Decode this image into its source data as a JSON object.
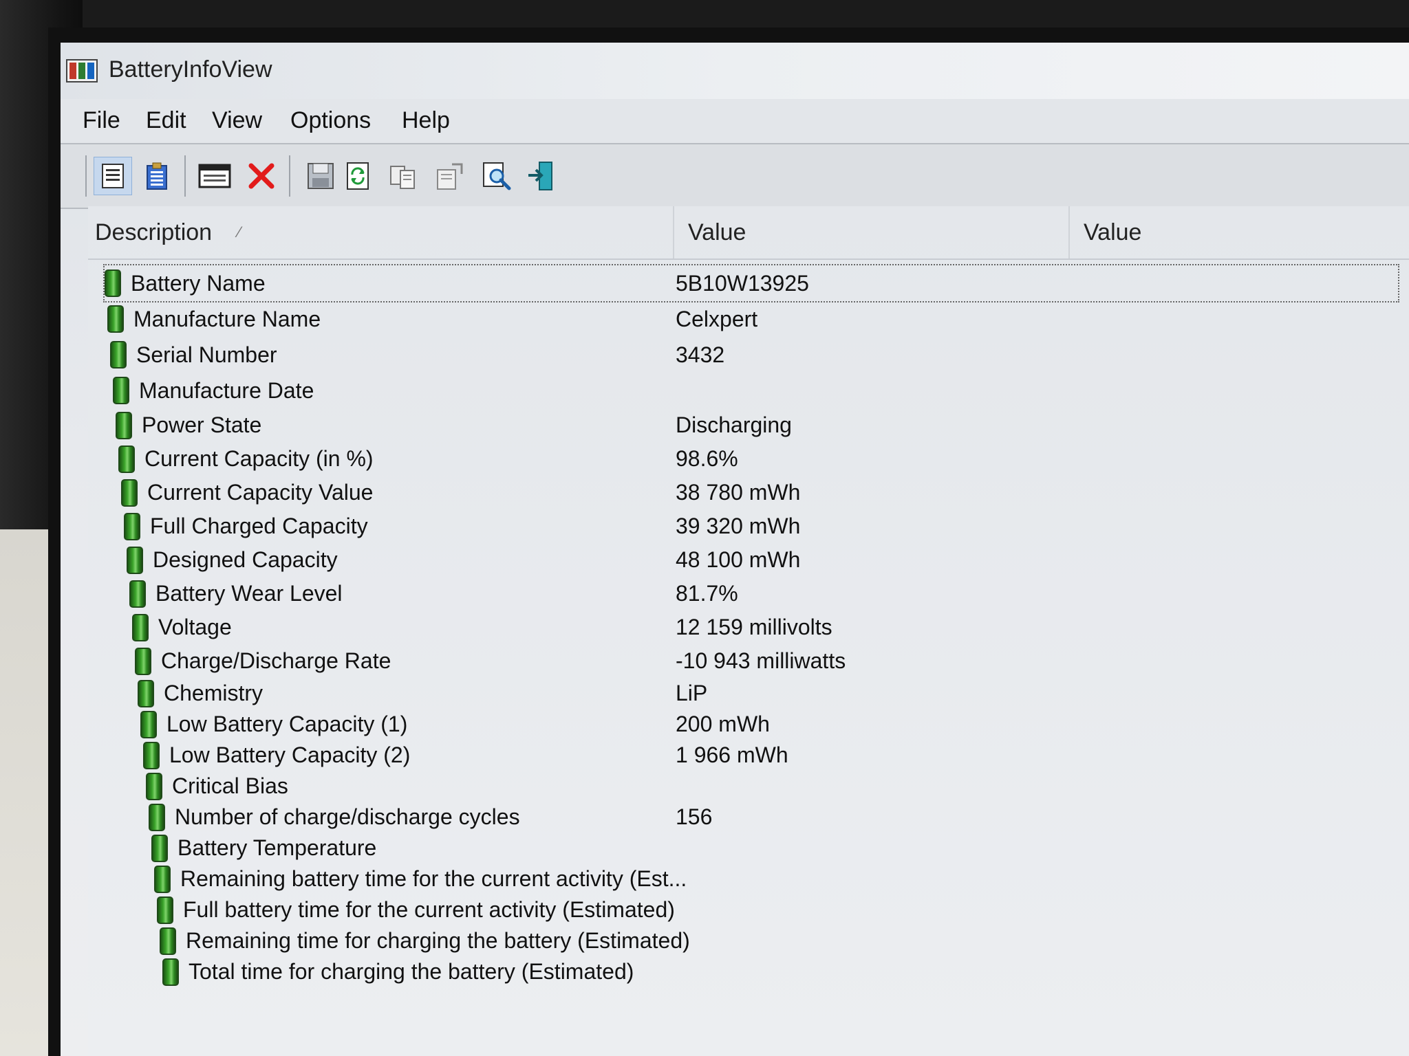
{
  "window": {
    "title": "BatteryInfoView"
  },
  "menu": [
    "File",
    "Edit",
    "View",
    "Options",
    "Help"
  ],
  "toolbar": [
    {
      "icon": "html-report-icon"
    },
    {
      "icon": "log-view-icon"
    },
    {
      "icon": "properties-window-icon"
    },
    {
      "icon": "delete-icon"
    },
    {
      "icon": "save-icon"
    },
    {
      "icon": "refresh-icon"
    },
    {
      "icon": "copy-icon"
    },
    {
      "icon": "properties-icon"
    },
    {
      "icon": "find-icon"
    },
    {
      "icon": "exit-icon"
    }
  ],
  "columns": {
    "description": "Description",
    "value1": "Value",
    "value2": "Value"
  },
  "rows": [
    {
      "description": "Battery Name",
      "value": "5B10W13925"
    },
    {
      "description": "Manufacture Name",
      "value": "Celxpert"
    },
    {
      "description": "Serial Number",
      "value": "3432"
    },
    {
      "description": "Manufacture Date",
      "value": ""
    },
    {
      "description": "Power State",
      "value": "Discharging"
    },
    {
      "description": "Current Capacity (in %)",
      "value": "98.6%"
    },
    {
      "description": "Current Capacity Value",
      "value": "38 780 mWh"
    },
    {
      "description": "Full Charged Capacity",
      "value": "39 320 mWh"
    },
    {
      "description": "Designed Capacity",
      "value": "48 100 mWh"
    },
    {
      "description": "Battery Wear Level",
      "value": "81.7%"
    },
    {
      "description": "Voltage",
      "value": "12 159 millivolts"
    },
    {
      "description": "Charge/Discharge Rate",
      "value": "-10 943 milliwatts"
    },
    {
      "description": "Chemistry",
      "value": "LiP"
    },
    {
      "description": "Low Battery Capacity (1)",
      "value": "200 mWh"
    },
    {
      "description": "Low Battery Capacity (2)",
      "value": "1 966 mWh"
    },
    {
      "description": "Critical Bias",
      "value": ""
    },
    {
      "description": "Number of charge/discharge cycles",
      "value": "156"
    },
    {
      "description": "Battery Temperature",
      "value": ""
    },
    {
      "description": "Remaining battery time for the current activity (Est...",
      "value": ""
    },
    {
      "description": "Full battery time for the current activity (Estimated)",
      "value": ""
    },
    {
      "description": "Remaining time for charging the battery (Estimated)",
      "value": ""
    },
    {
      "description": "Total  time for charging the battery (Estimated)",
      "value": ""
    }
  ]
}
